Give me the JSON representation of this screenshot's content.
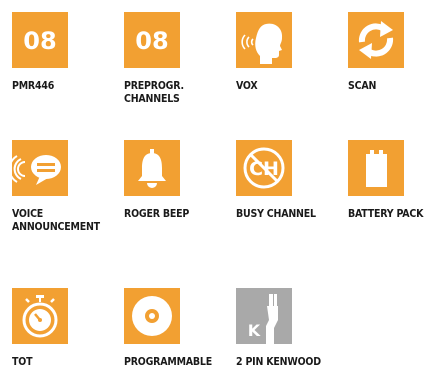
{
  "colors": {
    "accent": "#f2a032",
    "gray": "#a9a9a9",
    "text": "#1a1a1a"
  },
  "features": [
    {
      "icon": "number-08-icon",
      "number": "08",
      "label": "PMR446"
    },
    {
      "icon": "number-08-icon",
      "number": "08",
      "label": "PREPROGR. CHANNELS"
    },
    {
      "icon": "vox-head-speaking-icon",
      "label": "VOX"
    },
    {
      "icon": "scan-rotate-arrows-icon",
      "label": "SCAN"
    },
    {
      "icon": "voice-announcement-icon",
      "label": "VOICE ANNOUNCEMENT"
    },
    {
      "icon": "bell-icon",
      "label": "ROGER BEEP"
    },
    {
      "icon": "busy-channel-icon",
      "badge": "CH",
      "label": "BUSY CHANNEL"
    },
    {
      "icon": "battery-icon",
      "label": "BATTERY PACK"
    },
    {
      "icon": "stopwatch-icon",
      "label": "TOT"
    },
    {
      "icon": "disc-icon",
      "label": "PROGRAMMABLE"
    },
    {
      "icon": "kenwood-plug-icon",
      "badge": "K",
      "label": "2 PIN KENWOOD"
    }
  ]
}
